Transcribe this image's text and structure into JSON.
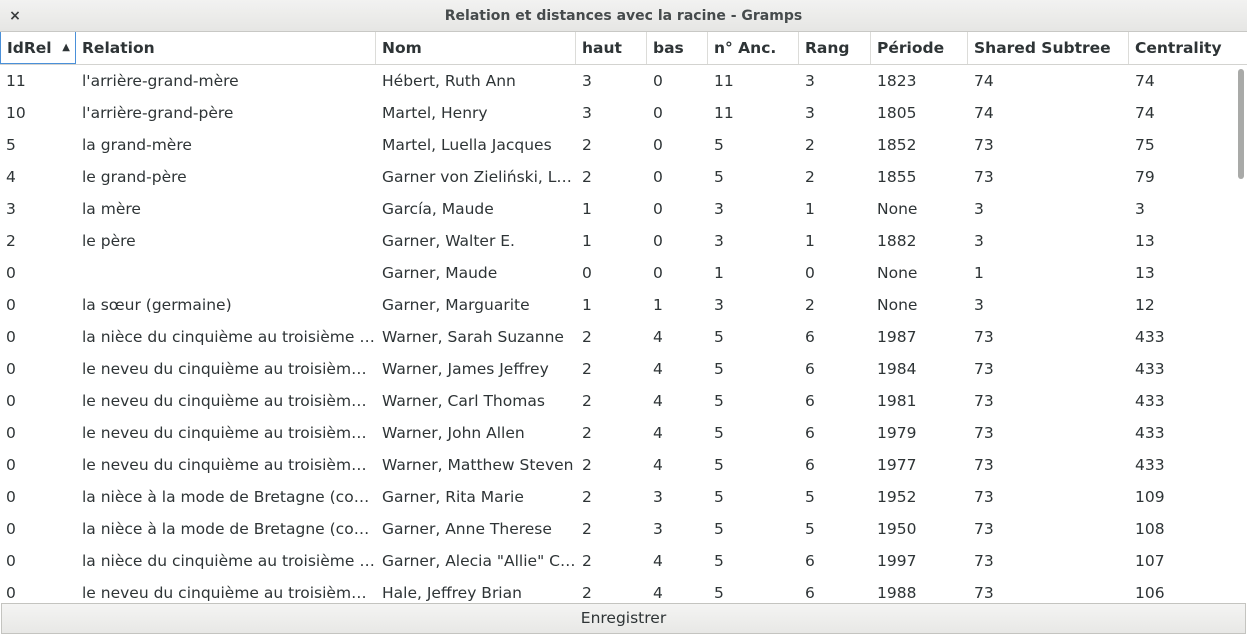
{
  "window": {
    "title": "Relation et distances avec la racine - Gramps",
    "close_glyph": "×"
  },
  "columns": [
    {
      "key": "idrel",
      "label": "IdRel"
    },
    {
      "key": "relation",
      "label": "Relation"
    },
    {
      "key": "nom",
      "label": "Nom"
    },
    {
      "key": "haut",
      "label": "haut"
    },
    {
      "key": "bas",
      "label": "bas"
    },
    {
      "key": "anc",
      "label": "n° Anc."
    },
    {
      "key": "rang",
      "label": "Rang"
    },
    {
      "key": "periode",
      "label": "Période"
    },
    {
      "key": "subtree",
      "label": "Shared Subtree"
    },
    {
      "key": "centrality",
      "label": "Centrality"
    }
  ],
  "sort": {
    "column": "idrel",
    "direction": "ascending",
    "indicator_glyph": "▲"
  },
  "rows": [
    {
      "idrel": "11",
      "relation": "l'arrière-grand-mère",
      "nom": "Hébert, Ruth Ann",
      "haut": "3",
      "bas": "0",
      "anc": "11",
      "rang": "3",
      "periode": "1823",
      "subtree": "74",
      "centrality": "74"
    },
    {
      "idrel": "10",
      "relation": "l'arrière-grand-père",
      "nom": "Martel, Henry",
      "haut": "3",
      "bas": "0",
      "anc": "11",
      "rang": "3",
      "periode": "1805",
      "subtree": "74",
      "centrality": "74"
    },
    {
      "idrel": "5",
      "relation": "la grand-mère",
      "nom": "Martel, Luella Jacques",
      "haut": "2",
      "bas": "0",
      "anc": "5",
      "rang": "2",
      "periode": "1852",
      "subtree": "73",
      "centrality": "75"
    },
    {
      "idrel": "4",
      "relation": "le grand-père",
      "nom": "Garner von Zieliński, L…",
      "haut": "2",
      "bas": "0",
      "anc": "5",
      "rang": "2",
      "periode": "1855",
      "subtree": "73",
      "centrality": "79"
    },
    {
      "idrel": "3",
      "relation": "la mère",
      "nom": "García, Maude",
      "haut": "1",
      "bas": "0",
      "anc": "3",
      "rang": "1",
      "periode": "None",
      "subtree": "3",
      "centrality": "3"
    },
    {
      "idrel": "2",
      "relation": "le père",
      "nom": "Garner, Walter E.",
      "haut": "1",
      "bas": "0",
      "anc": "3",
      "rang": "1",
      "periode": "1882",
      "subtree": "3",
      "centrality": "13"
    },
    {
      "idrel": "0",
      "relation": "",
      "nom": "Garner, Maude",
      "haut": "0",
      "bas": "0",
      "anc": "1",
      "rang": "0",
      "periode": "None",
      "subtree": "1",
      "centrality": "13"
    },
    {
      "idrel": "0",
      "relation": "la sœur (germaine)",
      "nom": "Garner, Marguarite",
      "haut": "1",
      "bas": "1",
      "anc": "3",
      "rang": "2",
      "periode": "None",
      "subtree": "3",
      "centrality": "12"
    },
    {
      "idrel": "0",
      "relation": "la nièce du cinquième au troisième …",
      "nom": "Warner, Sarah Suzanne",
      "haut": "2",
      "bas": "4",
      "anc": "5",
      "rang": "6",
      "periode": "1987",
      "subtree": "73",
      "centrality": "433"
    },
    {
      "idrel": "0",
      "relation": "le neveu du cinquième au troisième …",
      "nom": "Warner, James Jeffrey",
      "haut": "2",
      "bas": "4",
      "anc": "5",
      "rang": "6",
      "periode": "1984",
      "subtree": "73",
      "centrality": "433"
    },
    {
      "idrel": "0",
      "relation": "le neveu du cinquième au troisième …",
      "nom": "Warner, Carl Thomas",
      "haut": "2",
      "bas": "4",
      "anc": "5",
      "rang": "6",
      "periode": "1981",
      "subtree": "73",
      "centrality": "433"
    },
    {
      "idrel": "0",
      "relation": "le neveu du cinquième au troisième …",
      "nom": "Warner, John Allen",
      "haut": "2",
      "bas": "4",
      "anc": "5",
      "rang": "6",
      "periode": "1979",
      "subtree": "73",
      "centrality": "433"
    },
    {
      "idrel": "0",
      "relation": "le neveu du cinquième au troisième …",
      "nom": "Warner, Matthew Steven",
      "haut": "2",
      "bas": "4",
      "anc": "5",
      "rang": "6",
      "periode": "1977",
      "subtree": "73",
      "centrality": "433"
    },
    {
      "idrel": "0",
      "relation": "la nièce à la mode de Bretagne (cou…",
      "nom": "Garner, Rita Marie",
      "haut": "2",
      "bas": "3",
      "anc": "5",
      "rang": "5",
      "periode": "1952",
      "subtree": "73",
      "centrality": "109"
    },
    {
      "idrel": "0",
      "relation": "la nièce à la mode de Bretagne (cou…",
      "nom": "Garner, Anne Therese",
      "haut": "2",
      "bas": "3",
      "anc": "5",
      "rang": "5",
      "periode": "1950",
      "subtree": "73",
      "centrality": "108"
    },
    {
      "idrel": "0",
      "relation": "la nièce du cinquième au troisième …",
      "nom": "Garner, Alecia \"Allie\" Cl…",
      "haut": "2",
      "bas": "4",
      "anc": "5",
      "rang": "6",
      "periode": "1997",
      "subtree": "73",
      "centrality": "107"
    },
    {
      "idrel": "0",
      "relation": "le neveu du cinquième au troisième …",
      "nom": "Hale, Jeffrey Brian",
      "haut": "2",
      "bas": "4",
      "anc": "5",
      "rang": "6",
      "periode": "1988",
      "subtree": "73",
      "centrality": "106"
    }
  ],
  "footer": {
    "save_label": "Enregistrer"
  }
}
